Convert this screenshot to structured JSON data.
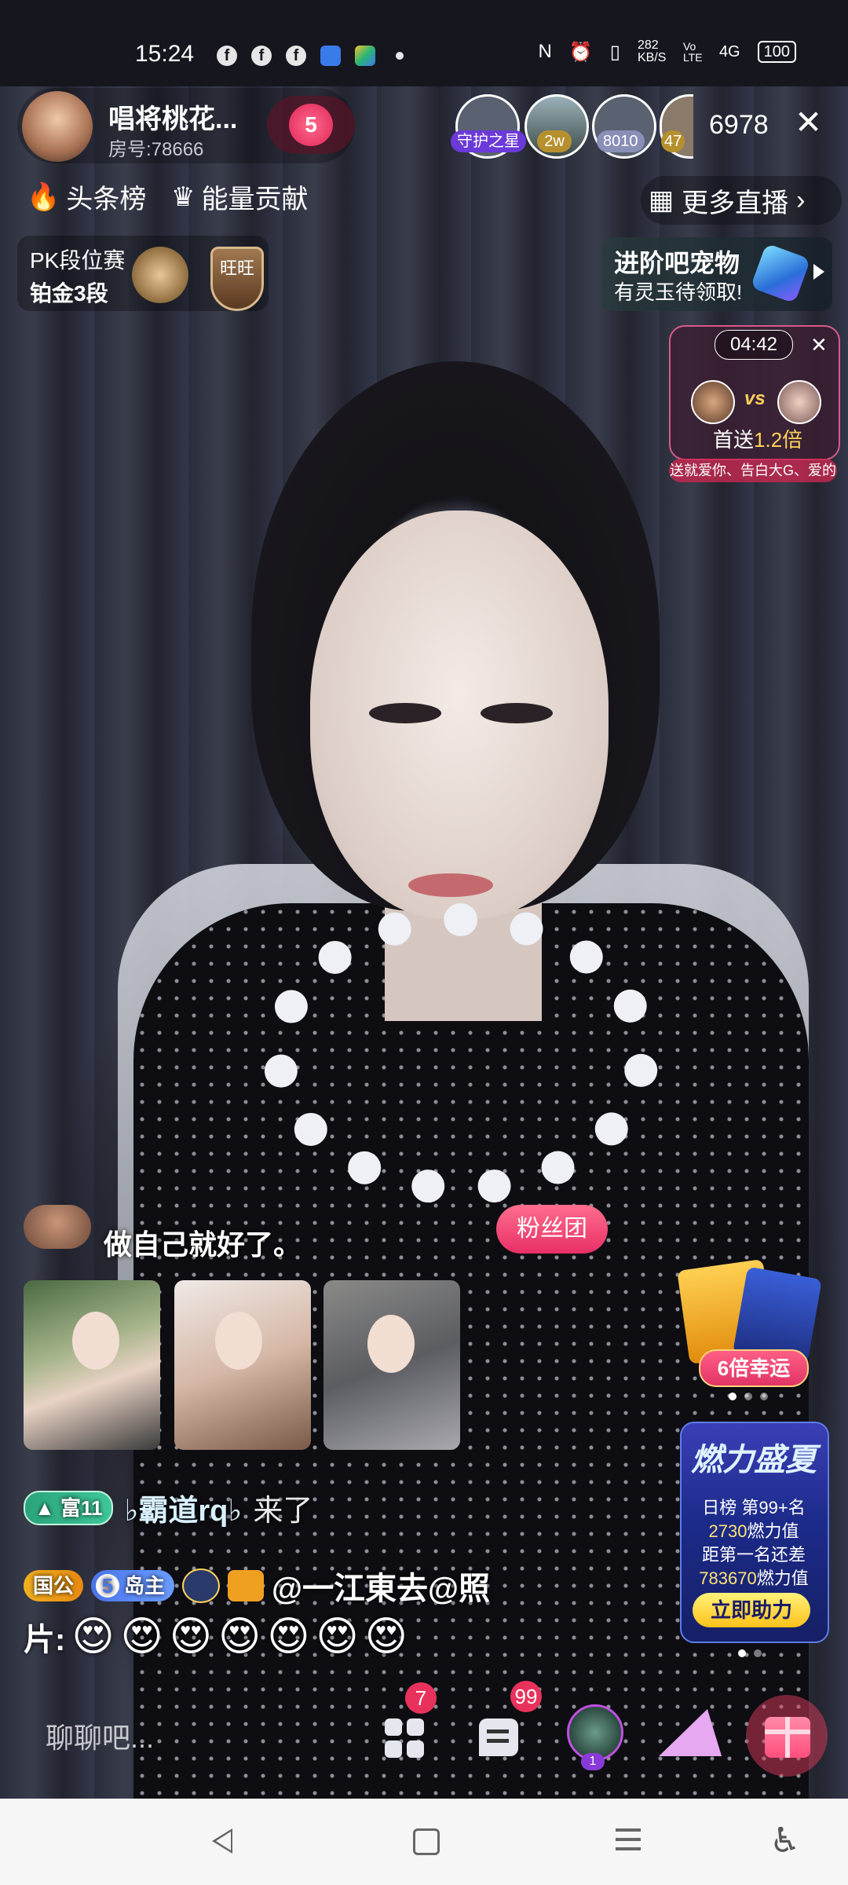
{
  "status_bar": {
    "time": "15:24",
    "network_speed": "282 KB/S",
    "signal": "4G",
    "volte": "Vo LTE",
    "battery": "100"
  },
  "header": {
    "host_name": "唱将桃花...",
    "room_number": "房号:78666",
    "like_level": "5",
    "viewers": [
      {
        "tag": "守护之星"
      },
      {
        "tag": "2w"
      },
      {
        "tag": "8010"
      },
      {
        "tag": "47"
      }
    ],
    "viewer_count": "6978",
    "close_icon": "close-icon"
  },
  "nav_row": {
    "headline_rank": "头条榜",
    "energy_contribution": "能量贡献",
    "more_live": "更多直播"
  },
  "pk_season": {
    "title": "PK段位赛",
    "rank": "铂金3段",
    "badge_text": "旺旺"
  },
  "pet_banner": {
    "title": "进阶吧宠物",
    "subtitle": "有灵玉待领取!"
  },
  "pk_widget": {
    "timer": "04:42",
    "vs": "vs",
    "first_gift_prefix": "首送",
    "first_gift_multiplier": "1.2倍",
    "marquee": "送就爱你、告白大G、爱的"
  },
  "chat": {
    "message": "做自己就好了。",
    "fans_button": "粉丝团",
    "join": {
      "level_tag": "富11",
      "user": "♭霸道rq♭",
      "action": "来了"
    },
    "gift_message": {
      "noble_tag": "国公",
      "fan_level": "5",
      "fan_title": "岛主",
      "text_line1": "@一江東去@照",
      "text_line2_prefix": "片:",
      "emojis": [
        "😍",
        "😍",
        "😍",
        "😍",
        "😍",
        "😍",
        "😍"
      ]
    }
  },
  "right_widgets": {
    "luck_label": "6倍幸运",
    "summer": {
      "title": "燃力盛夏",
      "rank_prefix": "日榜 ",
      "rank_value": "第99+名",
      "value_num": "2730",
      "value_unit": "燃力值",
      "gap_label": "距第一名还差",
      "gap_num": "783670",
      "gap_unit": "燃力值",
      "button": "立即助力"
    }
  },
  "bottom_bar": {
    "chat_placeholder": "聊聊吧...",
    "apps_badge": "7",
    "messages_badge": "99",
    "robot_level": "1"
  },
  "colors": {
    "accent_pink": "#e8325c",
    "gold": "#ffd25a",
    "summer_blue": "#1c2b8a"
  }
}
